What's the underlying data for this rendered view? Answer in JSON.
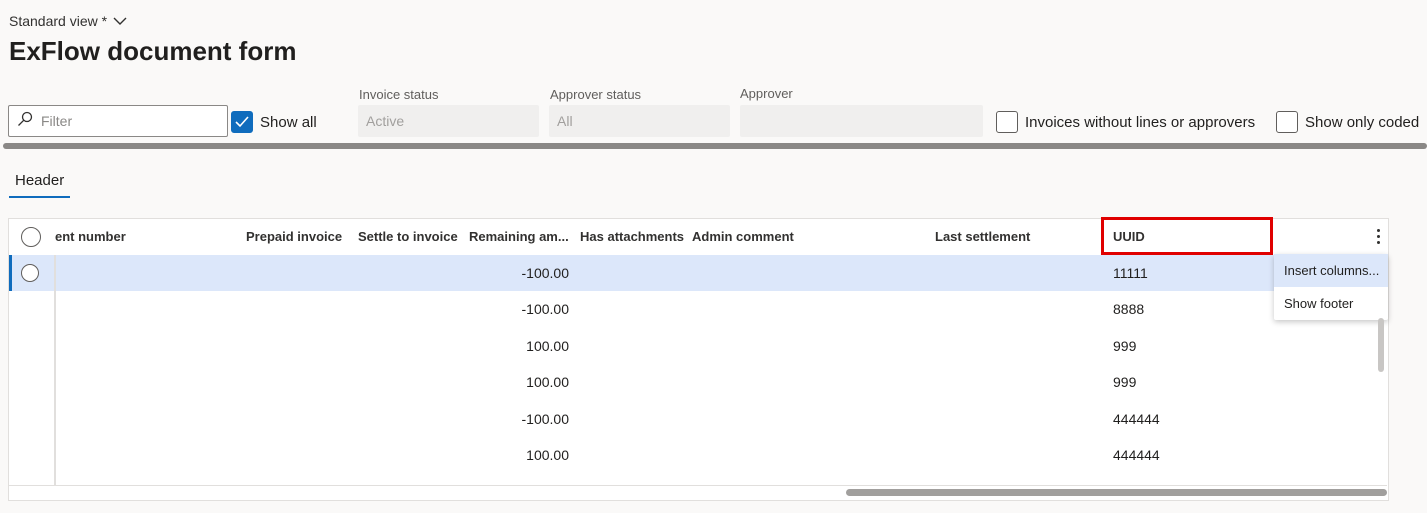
{
  "view": {
    "name": "Standard view *"
  },
  "page": {
    "title": "ExFlow document form"
  },
  "filters": {
    "filter_placeholder": "Filter",
    "show_all_label": "Show all",
    "invoice_status": {
      "label": "Invoice status",
      "value": "Active"
    },
    "approver_status": {
      "label": "Approver status",
      "value": "All"
    },
    "approver": {
      "label": "Approver",
      "value": ""
    },
    "no_lines_label": "Invoices without lines or approvers",
    "show_only_coded_label": "Show only coded"
  },
  "tabs": {
    "header": "Header"
  },
  "grid": {
    "columns": {
      "document_number": "ent number",
      "prepaid_invoice": "Prepaid invoice",
      "settle_to_invoice": "Settle to invoice",
      "remaining_amount": "Remaining am...",
      "has_attachments": "Has attachments",
      "admin_comment": "Admin comment",
      "last_settlement": "Last settlement",
      "uuid": "UUID"
    },
    "rows": [
      {
        "remaining_amount": "-100.00",
        "uuid": "11111"
      },
      {
        "remaining_amount": "-100.00",
        "uuid": "8888"
      },
      {
        "remaining_amount": "100.00",
        "uuid": "999"
      },
      {
        "remaining_amount": "100.00",
        "uuid": "999"
      },
      {
        "remaining_amount": "-100.00",
        "uuid": "444444"
      },
      {
        "remaining_amount": "100.00",
        "uuid": "444444"
      }
    ]
  },
  "context_menu": {
    "insert_columns": "Insert columns...",
    "show_footer": "Show footer"
  },
  "icons": {
    "view_dropdown": "chevron-down-icon",
    "filter": "search-icon",
    "checkmark": "check-icon",
    "more": "more-vertical-icon"
  },
  "colors": {
    "accent": "#0f6cbd",
    "selected_row": "#dce7fa",
    "highlight_box": "#e00000"
  }
}
